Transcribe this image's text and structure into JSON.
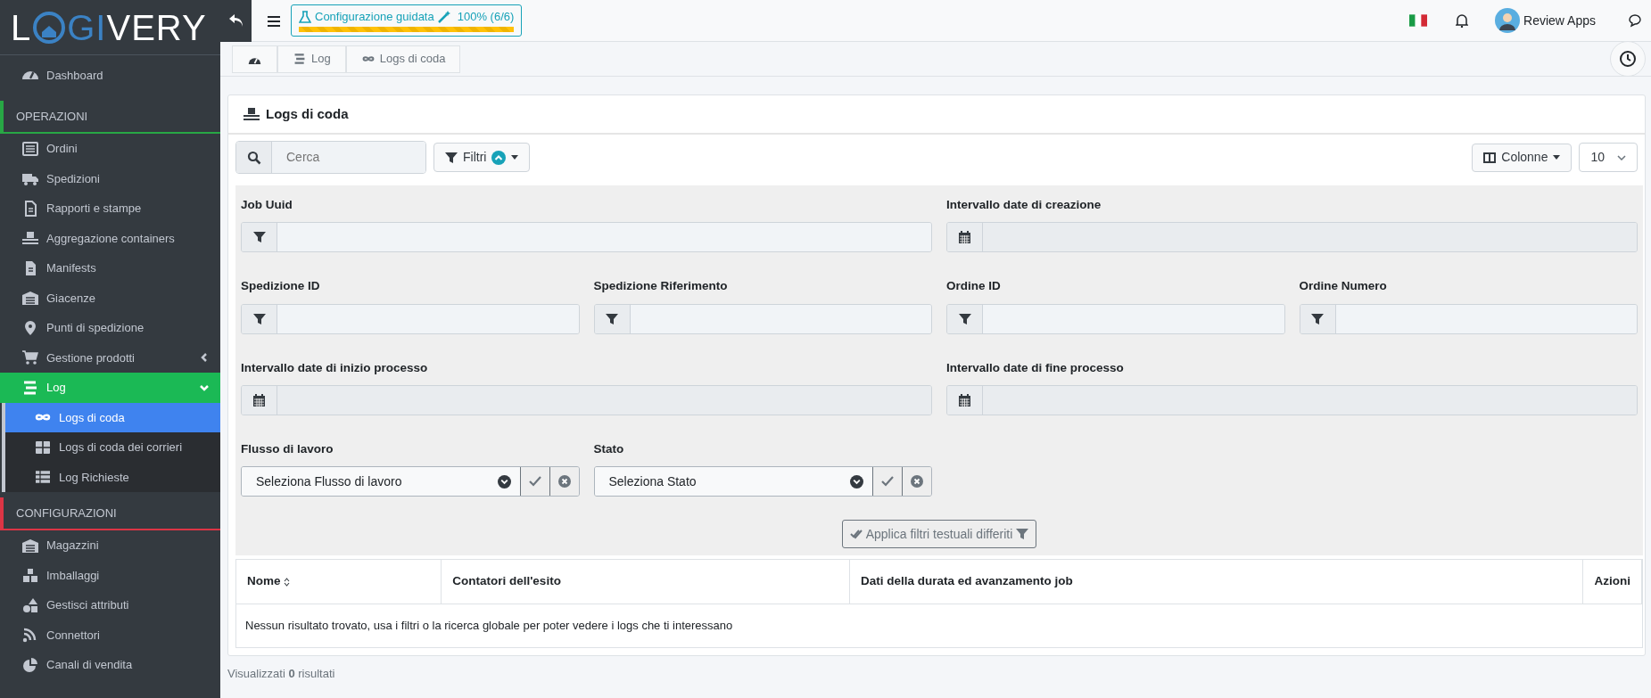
{
  "logo": {
    "before": "L",
    "accent": "GI",
    "after": "VERY"
  },
  "sidebar": [
    {
      "kind": "link",
      "label": "Dashboard",
      "selected": false
    },
    {
      "kind": "header",
      "label": "OPERAZIONI",
      "color": "#28a745"
    },
    {
      "kind": "link",
      "label": "Ordini",
      "selected": false
    },
    {
      "kind": "link",
      "label": "Spedizioni",
      "selected": false
    },
    {
      "kind": "link",
      "label": "Rapporti e stampe",
      "selected": false
    },
    {
      "kind": "link",
      "label": "Aggregazione containers",
      "selected": false
    },
    {
      "kind": "link",
      "label": "Manifests",
      "selected": false
    },
    {
      "kind": "link",
      "label": "Giacenze",
      "selected": false
    },
    {
      "kind": "link",
      "label": "Punti di spedizione",
      "selected": false
    },
    {
      "kind": "group",
      "label": "Gestione prodotti",
      "selected": false,
      "expanded": false
    },
    {
      "kind": "group",
      "label": "Log",
      "selected": true,
      "expanded": true,
      "children": [
        {
          "label": "Logs di coda",
          "selected": true
        },
        {
          "label": "Logs di coda dei corrieri",
          "selected": false
        },
        {
          "label": "Log Richieste",
          "selected": false
        }
      ]
    },
    {
      "kind": "header",
      "label": "CONFIGURAZIONI",
      "color": "#dc3545"
    },
    {
      "kind": "link",
      "label": "Magazzini",
      "selected": false
    },
    {
      "kind": "link",
      "label": "Imballaggi",
      "selected": false
    },
    {
      "kind": "link",
      "label": "Gestisci attributi",
      "selected": false
    },
    {
      "kind": "link",
      "label": "Connettori",
      "selected": false
    },
    {
      "kind": "link",
      "label": "Canali di vendita",
      "selected": false
    }
  ],
  "topbar": {
    "wizard": {
      "label": "Configurazione guidata",
      "progress": "100% (6/6)",
      "level": 1
    },
    "user": "Review Apps"
  },
  "breadcrumb": [
    {
      "label": "Log"
    },
    {
      "label": "Logs di coda"
    }
  ],
  "card": {
    "title": "Logs di coda",
    "search": {
      "placeholder": "Cerca"
    },
    "filters_button": {
      "label": "Filtri",
      "expanded": true
    },
    "columns_button": "Colonne",
    "page_size": "10",
    "filter_rows": [
      [
        {
          "kind": "text",
          "label": "Job Uuid"
        },
        {
          "kind": "daterange",
          "label": "Intervallo date di creazione"
        }
      ],
      [
        {
          "kind": "text",
          "label": "Spedizione ID"
        },
        {
          "kind": "text",
          "label": "Spedizione Riferimento"
        },
        {
          "kind": "text",
          "label": "Ordine ID"
        },
        {
          "kind": "text",
          "label": "Ordine Numero"
        }
      ],
      [
        {
          "kind": "daterange",
          "label": "Intervallo date di inizio processo"
        },
        {
          "kind": "daterange",
          "label": "Intervallo date di fine processo"
        }
      ],
      [
        {
          "kind": "select",
          "label": "Flusso di lavoro",
          "value": "Seleziona Flusso di lavoro"
        },
        {
          "kind": "select",
          "label": "Stato",
          "value": "Seleziona Stato"
        }
      ]
    ],
    "apply_button": "Applica filtri testuali differiti",
    "table": {
      "columns": [
        {
          "label": "Nome",
          "sortable": true
        },
        {
          "label": "Contatori dell'esito",
          "sortable": false
        },
        {
          "label": "Dati della durata ed avanzamento job",
          "sortable": false
        },
        {
          "label": "Azioni",
          "sortable": false
        }
      ],
      "empty_message": "Nessun risultato trovato, usa i filtri o la ricerca globale per poter vedere i logs che ti interessano"
    },
    "footer": "Visualizzati **0** risultati"
  }
}
